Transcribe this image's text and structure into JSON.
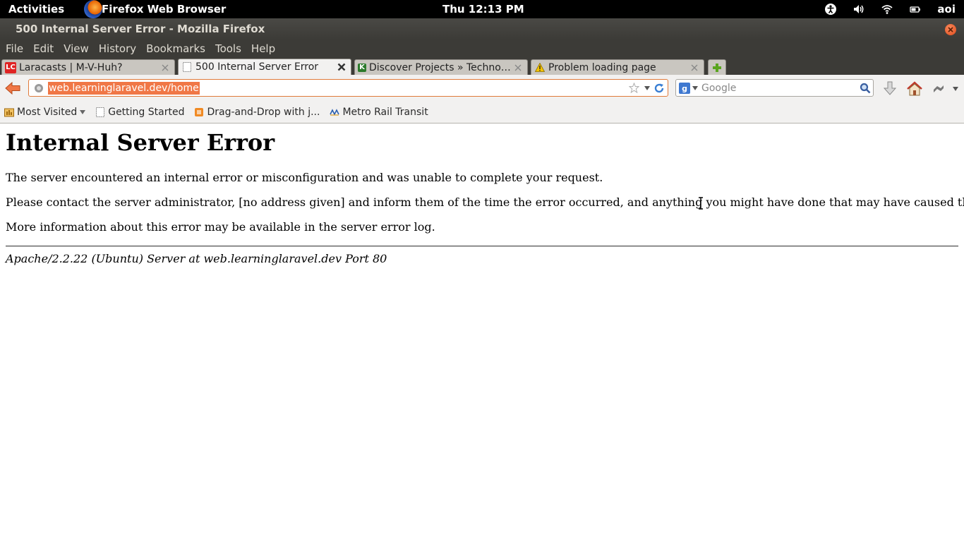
{
  "top_panel": {
    "activities": "Activities",
    "app_name": "Firefox Web Browser",
    "clock": "Thu 12:13 PM",
    "tray_icons": [
      "accessibility-icon",
      "volume-icon",
      "wifi-icon",
      "battery-icon"
    ],
    "user": "aoi"
  },
  "window": {
    "title": "500 Internal Server Error - Mozilla Firefox"
  },
  "menu": {
    "items": [
      "File",
      "Edit",
      "View",
      "History",
      "Bookmarks",
      "Tools",
      "Help"
    ]
  },
  "tabs": [
    {
      "label": "Laracasts | M-V-Huh?",
      "favicon": "LC",
      "active": false
    },
    {
      "label": "500 Internal Server Error",
      "favicon": "",
      "active": true
    },
    {
      "label": "Discover Projects » Technol...",
      "favicon": "K",
      "active": false
    },
    {
      "label": "Problem loading page",
      "favicon": "warning",
      "active": false
    }
  ],
  "urlbar": {
    "value": "web.learninglaravel.dev/home"
  },
  "search": {
    "placeholder": "Google"
  },
  "bookmarks": [
    {
      "label": "Most Visited",
      "icon": "most-visited-icon"
    },
    {
      "label": "Getting Started",
      "icon": "page-icon"
    },
    {
      "label": "Drag-and-Drop with j...",
      "icon": "bookmark-icon"
    },
    {
      "label": "Metro Rail Transit",
      "icon": "metro-icon"
    }
  ],
  "page": {
    "heading": "Internal Server Error",
    "p1": "The server encountered an internal error or misconfiguration and was unable to complete your request.",
    "p2": "Please contact the server administrator, [no address given] and inform them of the time the error occurred, and anything you might have done that may have caused the error.",
    "p3": "More information about this error may be available in the server error log.",
    "address": "Apache/2.2.22 (Ubuntu) Server at web.learninglaravel.dev Port 80"
  },
  "colors": {
    "panel": "#000000",
    "chrome": "#3c3b37",
    "toolbar": "#f2f1f0",
    "url_highlight": "#f07746",
    "url_border": "#e07a3a"
  }
}
